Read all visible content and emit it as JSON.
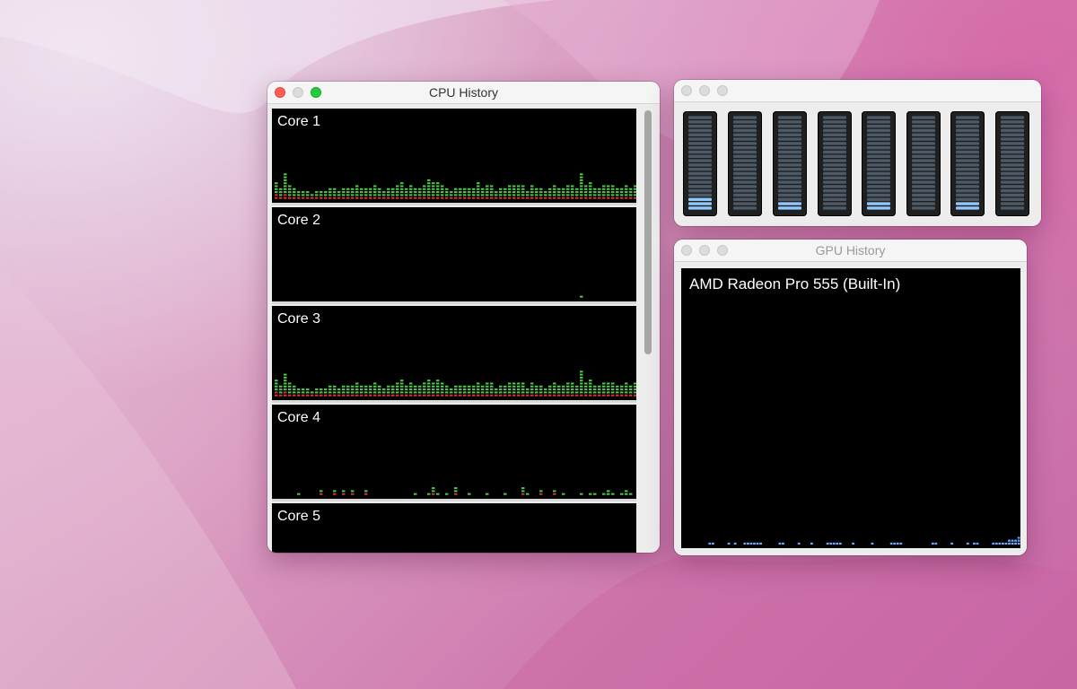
{
  "cpu_history": {
    "title": "CPU History",
    "cores": [
      {
        "label": "Core 1",
        "user_bars": [
          4,
          3,
          7,
          4,
          3,
          2,
          2,
          2,
          1,
          2,
          2,
          2,
          3,
          3,
          2,
          3,
          3,
          3,
          4,
          3,
          3,
          3,
          4,
          3,
          2,
          3,
          3,
          4,
          5,
          3,
          4,
          3,
          3,
          4,
          6,
          5,
          5,
          4,
          3,
          2,
          3,
          3,
          3,
          3,
          3,
          5,
          3,
          4,
          4,
          2,
          3,
          3,
          4,
          4,
          4,
          4,
          2,
          4,
          3,
          3,
          2,
          3,
          4,
          3,
          3,
          4,
          4,
          3,
          8,
          4,
          5,
          3,
          3,
          4,
          4,
          4,
          3,
          3,
          4,
          3,
          4,
          3
        ],
        "system_levels": [
          2,
          1,
          2,
          1,
          1,
          1,
          1,
          1,
          1,
          1,
          1,
          1,
          1,
          1,
          1,
          1,
          1,
          1,
          1,
          1,
          1,
          1,
          1,
          1,
          1,
          1,
          1,
          1,
          1,
          1,
          1,
          1,
          1,
          1,
          1,
          1,
          1,
          1,
          1,
          1,
          1,
          1,
          1,
          1,
          1,
          1,
          1,
          1,
          1,
          1,
          1,
          1,
          1,
          1,
          1,
          1,
          1,
          1,
          1,
          1,
          1,
          1,
          1,
          1,
          1,
          1,
          1,
          1,
          1,
          1,
          1,
          1,
          1,
          1,
          1,
          1,
          1,
          1,
          1,
          1,
          1,
          1
        ]
      },
      {
        "label": "Core 2",
        "user_bars": [
          0,
          0,
          0,
          0,
          0,
          0,
          0,
          0,
          0,
          0,
          0,
          0,
          0,
          0,
          0,
          0,
          0,
          0,
          0,
          0,
          0,
          0,
          0,
          0,
          0,
          0,
          0,
          0,
          0,
          0,
          0,
          0,
          0,
          0,
          0,
          0,
          0,
          0,
          0,
          0,
          0,
          0,
          0,
          0,
          0,
          0,
          0,
          0,
          0,
          0,
          0,
          0,
          0,
          0,
          0,
          0,
          0,
          0,
          0,
          0,
          0,
          0,
          0,
          0,
          0,
          0,
          0,
          0,
          1,
          0,
          0,
          0,
          0,
          0,
          0,
          0,
          0,
          0,
          0,
          0,
          0,
          0
        ],
        "system_levels": [
          0,
          0,
          0,
          0,
          0,
          0,
          0,
          0,
          0,
          0,
          0,
          0,
          0,
          0,
          0,
          0,
          0,
          0,
          0,
          0,
          0,
          0,
          0,
          0,
          0,
          0,
          0,
          0,
          0,
          0,
          0,
          0,
          0,
          0,
          0,
          0,
          0,
          0,
          0,
          0,
          0,
          0,
          0,
          0,
          0,
          0,
          0,
          0,
          0,
          0,
          0,
          0,
          0,
          0,
          0,
          0,
          0,
          0,
          0,
          0,
          0,
          0,
          0,
          0,
          0,
          0,
          0,
          0,
          0,
          0,
          0,
          0,
          0,
          0,
          0,
          0,
          0,
          0,
          0,
          0,
          0,
          0
        ]
      },
      {
        "label": "Core 3",
        "user_bars": [
          4,
          3,
          6,
          4,
          3,
          2,
          2,
          2,
          1,
          2,
          2,
          2,
          3,
          3,
          2,
          3,
          3,
          3,
          4,
          3,
          3,
          3,
          4,
          3,
          2,
          3,
          3,
          4,
          5,
          3,
          4,
          3,
          3,
          4,
          5,
          4,
          5,
          4,
          3,
          2,
          3,
          3,
          3,
          3,
          3,
          4,
          3,
          4,
          4,
          2,
          3,
          3,
          4,
          4,
          4,
          4,
          2,
          4,
          3,
          3,
          2,
          3,
          4,
          3,
          3,
          4,
          4,
          3,
          8,
          4,
          5,
          3,
          3,
          4,
          4,
          4,
          3,
          3,
          4,
          3,
          4,
          3
        ],
        "system_levels": [
          2,
          1,
          2,
          1,
          1,
          1,
          1,
          1,
          1,
          1,
          1,
          1,
          1,
          1,
          1,
          1,
          1,
          1,
          1,
          1,
          1,
          1,
          1,
          1,
          1,
          1,
          1,
          1,
          1,
          1,
          1,
          1,
          1,
          1,
          1,
          1,
          1,
          1,
          1,
          1,
          1,
          1,
          1,
          1,
          1,
          1,
          1,
          1,
          1,
          1,
          1,
          1,
          1,
          1,
          1,
          1,
          1,
          1,
          1,
          1,
          1,
          1,
          1,
          1,
          1,
          1,
          1,
          1,
          1,
          1,
          1,
          1,
          1,
          1,
          1,
          1,
          1,
          1,
          1,
          1,
          1,
          1
        ]
      },
      {
        "label": "Core 4",
        "user_bars": [
          0,
          0,
          0,
          0,
          0,
          1,
          0,
          0,
          0,
          0,
          1,
          0,
          0,
          1,
          0,
          1,
          0,
          1,
          0,
          0,
          1,
          0,
          0,
          0,
          0,
          0,
          0,
          0,
          0,
          0,
          0,
          1,
          0,
          0,
          1,
          2,
          1,
          0,
          1,
          0,
          2,
          0,
          0,
          1,
          0,
          0,
          0,
          1,
          0,
          0,
          0,
          1,
          0,
          0,
          0,
          2,
          1,
          0,
          0,
          1,
          0,
          0,
          1,
          0,
          1,
          0,
          0,
          0,
          1,
          0,
          1,
          1,
          0,
          1,
          2,
          1,
          0,
          1,
          2,
          1,
          0,
          0
        ],
        "system_levels": [
          0,
          0,
          0,
          0,
          0,
          0,
          0,
          0,
          0,
          0,
          1,
          0,
          0,
          1,
          0,
          1,
          0,
          1,
          0,
          0,
          1,
          0,
          0,
          0,
          0,
          0,
          0,
          0,
          0,
          0,
          0,
          0,
          0,
          0,
          0,
          1,
          0,
          0,
          0,
          0,
          1,
          0,
          0,
          0,
          0,
          0,
          0,
          0,
          0,
          0,
          0,
          0,
          0,
          0,
          0,
          1,
          0,
          0,
          0,
          1,
          0,
          0,
          1,
          0,
          0,
          0,
          0,
          0,
          0,
          0,
          0,
          0,
          0,
          0,
          0,
          0,
          0,
          0,
          0,
          0,
          0,
          0
        ]
      },
      {
        "label": "Core 5",
        "user_bars": [],
        "system_levels": []
      }
    ]
  },
  "cpu_usage": {
    "title": "",
    "meter_levels": [
      3,
      0,
      2,
      0,
      2,
      0,
      2,
      0
    ]
  },
  "gpu_history": {
    "title": "GPU History",
    "gpu_name": "AMD Radeon Pro 555 (Built-In)",
    "bars": [
      0,
      0,
      0,
      0,
      0,
      0,
      0,
      0,
      1,
      1,
      0,
      0,
      0,
      0,
      1,
      0,
      1,
      0,
      0,
      1,
      1,
      1,
      1,
      1,
      1,
      0,
      0,
      0,
      0,
      0,
      1,
      1,
      0,
      0,
      0,
      0,
      1,
      0,
      0,
      0,
      1,
      0,
      0,
      0,
      0,
      1,
      1,
      1,
      1,
      1,
      0,
      0,
      0,
      1,
      0,
      0,
      0,
      0,
      0,
      1,
      0,
      0,
      0,
      0,
      0,
      1,
      1,
      1,
      1,
      0,
      0,
      0,
      0,
      0,
      0,
      0,
      0,
      0,
      1,
      1,
      0,
      0,
      0,
      0,
      1,
      0,
      0,
      0,
      0,
      1,
      0,
      1,
      1,
      0,
      0,
      0,
      0,
      1,
      1,
      1,
      1,
      1,
      2,
      2,
      2,
      3
    ]
  },
  "colors": {
    "user_green": "#4ec94a",
    "system_red": "#d8333a",
    "gpu_blue": "#6aa8ff",
    "meter_idle": "#4b5a66",
    "meter_active": "#8ec8ff"
  }
}
